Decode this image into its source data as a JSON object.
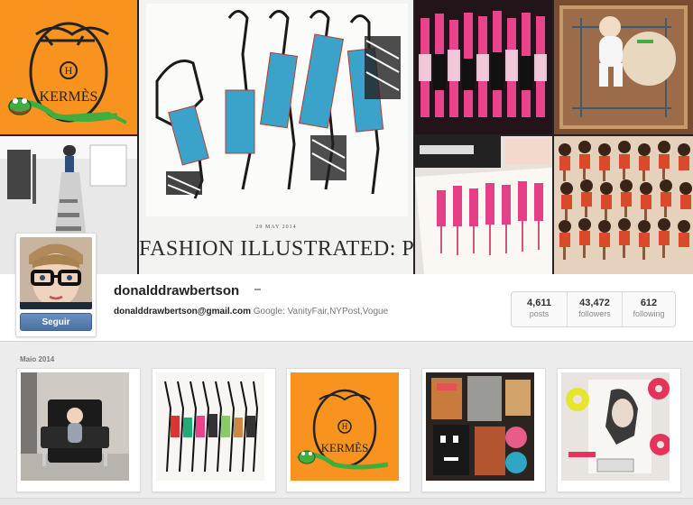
{
  "cover": {
    "fashion_date": "29 MAY 2014",
    "fashion_title": "FASHION ILLUSTRATED: PETIT DEJEUNER",
    "hermes_text": "KERMÈS",
    "hermes_monogram": "H"
  },
  "profile": {
    "username": "donalddrawbertson",
    "follow_label": "Seguir",
    "bio_email": "donalddrawbertson@gmail.com",
    "bio_text": "Google: VanityFair,NYPost,Vogue"
  },
  "stats": [
    {
      "value": "4,611",
      "label": "posts"
    },
    {
      "value": "43,472",
      "label": "followers"
    },
    {
      "value": "612",
      "label": "following"
    }
  ],
  "feed": {
    "month_label": "Maio 2014",
    "thumb3_text": "KERMÈS",
    "thumb3_monogram": "H"
  },
  "colors": {
    "hermes_orange": "#f7931e",
    "follow_blue": "#4a71a6",
    "kermit_green": "#3fae3f"
  }
}
